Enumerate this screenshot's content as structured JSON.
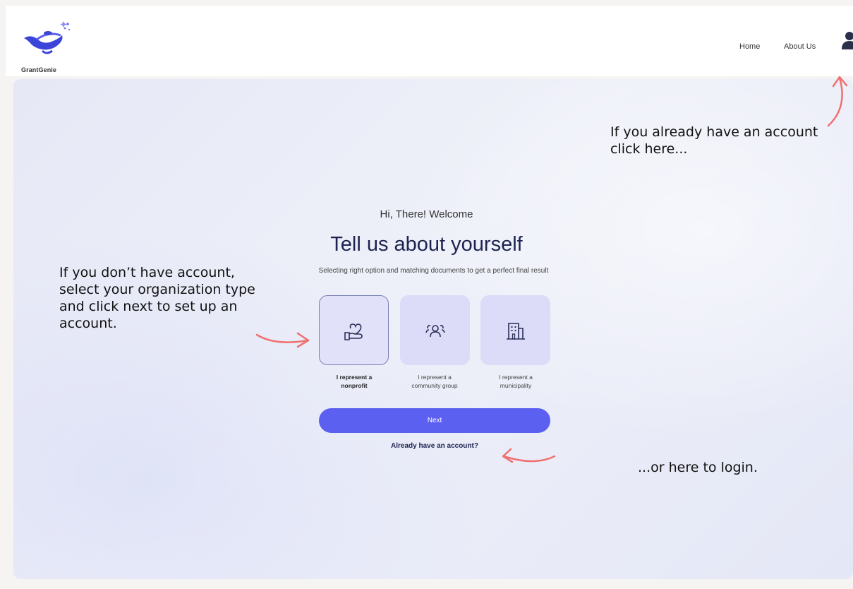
{
  "header": {
    "logo_text": "GrantGenie",
    "nav": [
      {
        "label": "Home"
      },
      {
        "label": "About Us"
      }
    ],
    "avatar_icon": "user-icon"
  },
  "welcome": {
    "greeting": "Hi, There! Welcome",
    "title": "Tell us about yourself",
    "subtitle": "Selecting right option and matching documents to get a perfect final result"
  },
  "options": [
    {
      "line1": "I represent a",
      "line2": "nonprofit",
      "icon": "heart-hand-icon",
      "selected": true
    },
    {
      "line1": "I represent a",
      "line2": "community group",
      "icon": "group-icon",
      "selected": false
    },
    {
      "line1": "I represent a",
      "line2": "municipality",
      "icon": "building-icon",
      "selected": false
    }
  ],
  "actions": {
    "next_label": "Next",
    "login_link": "Already have an account?"
  },
  "annotations": {
    "left_note": "If you don’t have account, select your organization type and click next to set up an account.",
    "top_note": "If you already have an account click here...",
    "bottom_note": "...or here to login."
  },
  "colors": {
    "accent": "#5b60f0",
    "arrow": "#f07070",
    "title": "#1e2350",
    "option_bg": "#dcdcf8"
  }
}
